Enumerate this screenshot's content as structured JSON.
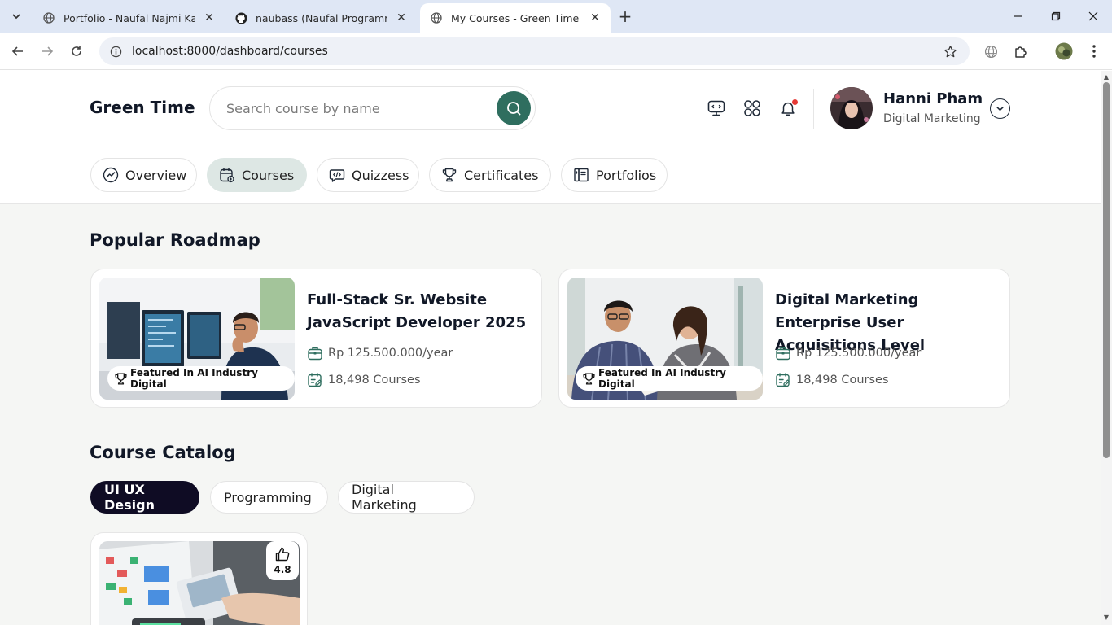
{
  "browser": {
    "tabs": [
      {
        "title": "Portfolio - Naufal Najmi Kardian",
        "favicon": "globe-icon",
        "active": false
      },
      {
        "title": "naubass (Naufal Programming)",
        "favicon": "github-icon",
        "active": false
      },
      {
        "title": "My Courses - Green Time",
        "favicon": "globe-icon",
        "active": true
      }
    ],
    "url": "localhost:8000/dashboard/courses"
  },
  "header": {
    "brand": "Green Time",
    "search_placeholder": "Search course by name",
    "user": {
      "name": "Hanni Pham",
      "role": "Digital Marketing"
    }
  },
  "nav": [
    {
      "label": "Overview",
      "icon": "trend-chart-icon",
      "active": false
    },
    {
      "label": "Courses",
      "icon": "calendar-courses-icon",
      "active": true
    },
    {
      "label": "Quizzess",
      "icon": "code-chat-icon",
      "active": false
    },
    {
      "label": "Certificates",
      "icon": "trophy-icon",
      "active": false
    },
    {
      "label": "Portfolios",
      "icon": "book-icon",
      "active": false
    }
  ],
  "roadmap": {
    "title": "Popular Roadmap",
    "cards": [
      {
        "title": "Full-Stack Sr. Website JavaScript Developer 2025",
        "badge": "Featured In AI Industry Digital",
        "price": "Rp 125.500.000/year",
        "courses": "18,498 Courses"
      },
      {
        "title": "Digital Marketing Enterprise User Acquisitions Level",
        "badge": "Featured In AI Industry Digital",
        "price": "Rp 125.500.000/year",
        "courses": "18,498 Courses"
      }
    ]
  },
  "catalog": {
    "title": "Course Catalog",
    "categories": [
      {
        "label": "UI UX Design",
        "active": true
      },
      {
        "label": "Programming",
        "active": false
      },
      {
        "label": "Digital Marketing",
        "active": false
      }
    ],
    "cards": [
      {
        "rating": "4.8"
      }
    ]
  },
  "colors": {
    "accent": "#2f6e5f",
    "active_nav_bg": "#dde7e4",
    "active_category_bg": "#0f0c24",
    "notification_dot": "#e53935"
  }
}
